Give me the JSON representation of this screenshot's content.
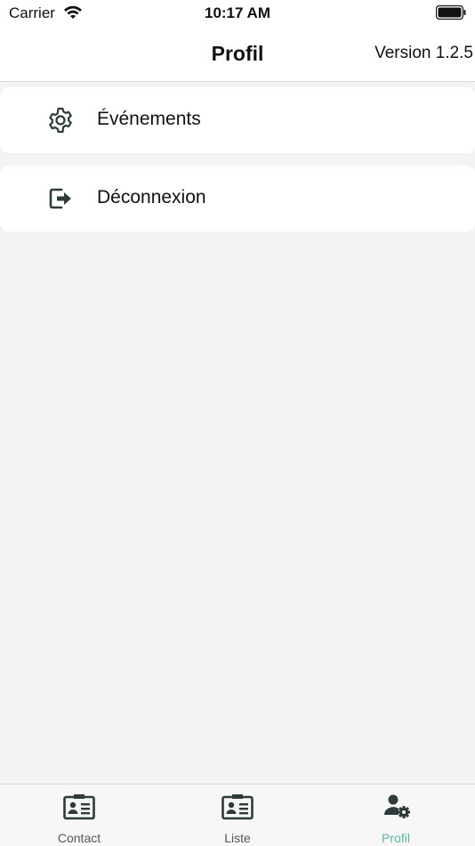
{
  "status_bar": {
    "carrier": "Carrier",
    "time": "10:17 AM",
    "icons": [
      "wifi-icon",
      "battery-icon"
    ]
  },
  "nav": {
    "title": "Profil",
    "version": "Version 1.2.5"
  },
  "menu": {
    "items": [
      {
        "label": "Événements",
        "icon": "gear-icon"
      },
      {
        "label": "Déconnexion",
        "icon": "logout-icon"
      }
    ]
  },
  "tab_bar": {
    "tabs": [
      {
        "label": "Contact",
        "icon": "contact-card-icon",
        "active": false
      },
      {
        "label": "Liste",
        "icon": "list-card-icon",
        "active": false
      },
      {
        "label": "Profil",
        "icon": "user-settings-icon",
        "active": true
      }
    ]
  },
  "colors": {
    "accent": "#5bb5a2",
    "icon_dark": "#2f3a3a",
    "background": "#f3f3f3"
  }
}
